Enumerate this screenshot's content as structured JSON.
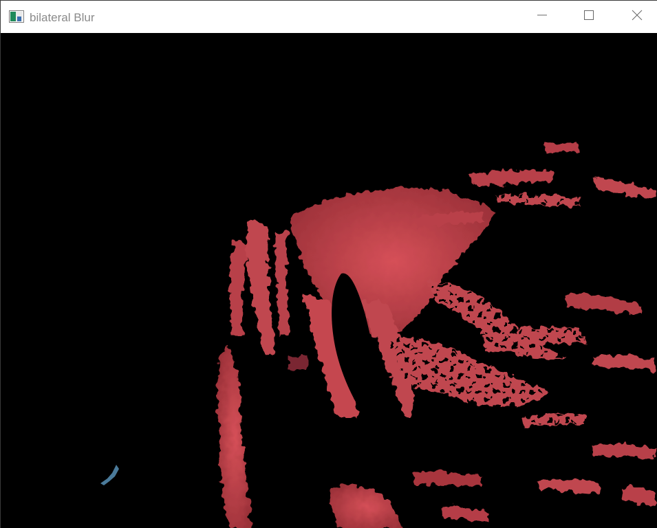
{
  "window": {
    "title": "bilateral Blur",
    "icon": "app-image-icon",
    "controls": [
      "minimize-icon",
      "maximize-icon",
      "close-icon"
    ]
  },
  "image_view": {
    "description_colors": {
      "background": "#000000",
      "blob": "#c0474f",
      "blob_dark": "#7a2830",
      "speck": "#4a7a9a"
    }
  }
}
